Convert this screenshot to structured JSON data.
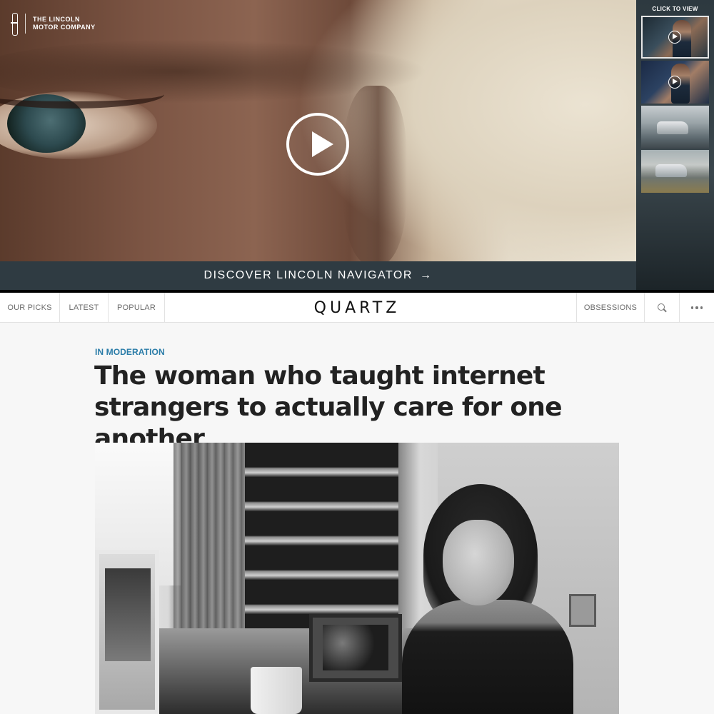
{
  "ad": {
    "brand_line1": "THE LINCOLN",
    "brand_line2": "MOTOR COMPANY",
    "cta_label": "DISCOVER LINCOLN NAVIGATOR",
    "cta_arrow": "→",
    "side_label": "CLICK TO VIEW",
    "thumbnails": [
      "video-1",
      "video-2",
      "image-suv-lake",
      "image-suv-road"
    ]
  },
  "nav": {
    "our_picks": "OUR PICKS",
    "latest": "LATEST",
    "popular": "POPULAR",
    "logo": "QUARTZ",
    "obsessions": "OBSESSIONS"
  },
  "article": {
    "kicker": "IN MODERATION",
    "headline": "The woman who taught internet strangers to actually care for one another"
  },
  "colors": {
    "kicker": "#2a7ca8",
    "cta_bar": "#2f3b42",
    "headline": "#222222"
  },
  "icons": [
    "lincoln-star-icon",
    "play-icon",
    "search-icon",
    "more-dots-icon",
    "arrow-right-icon"
  ]
}
